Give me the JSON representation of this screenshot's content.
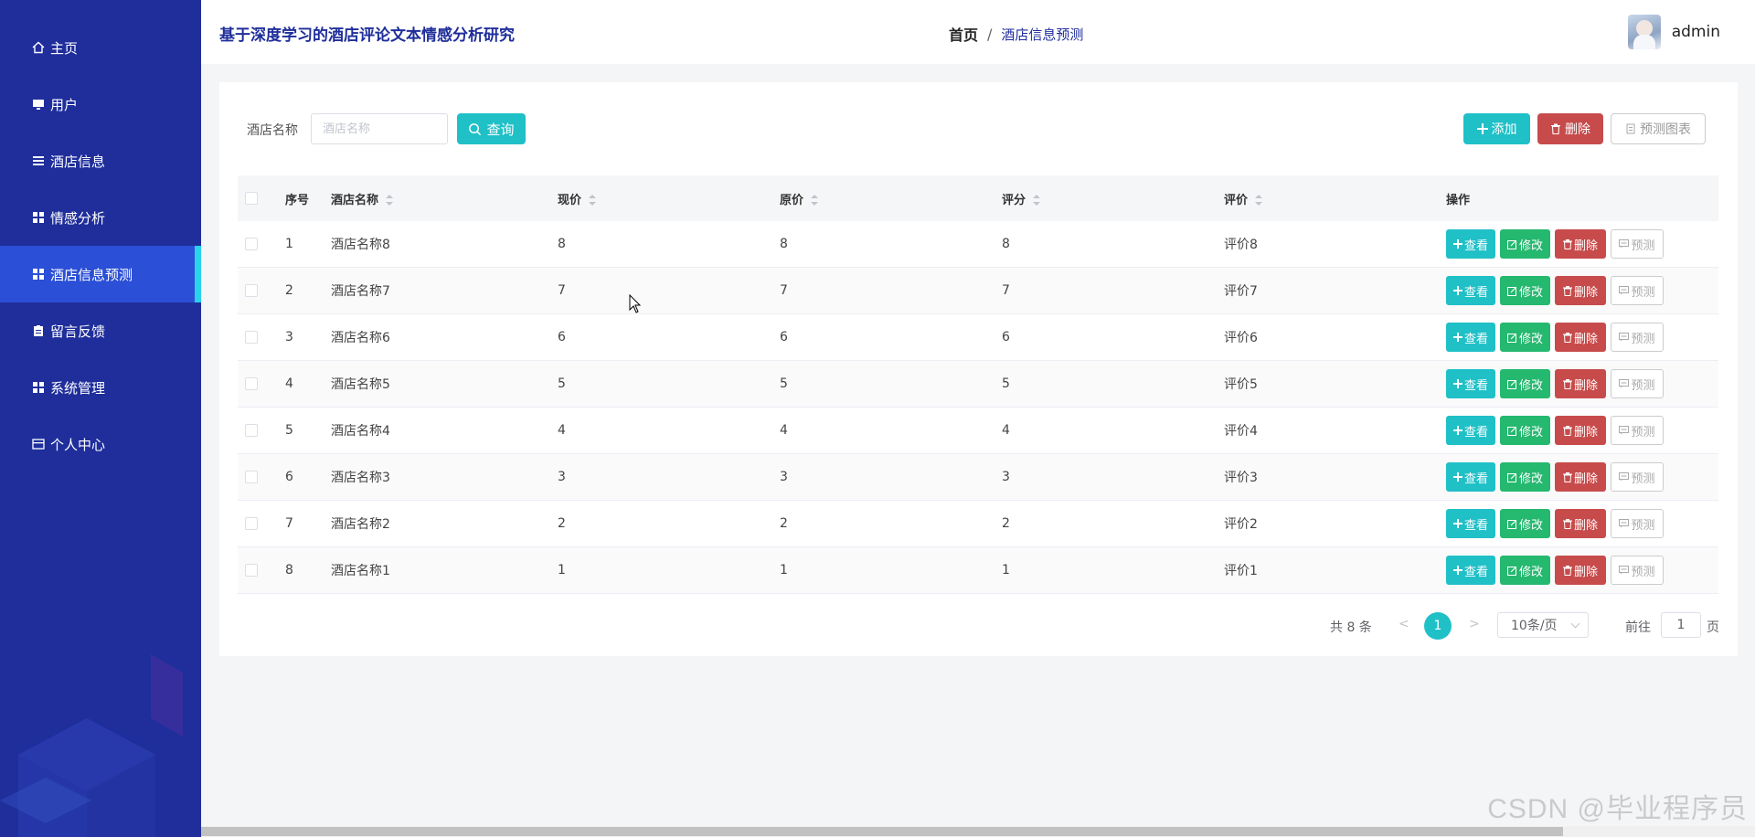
{
  "sidebar": {
    "items": [
      {
        "label": "主页",
        "icon": "home-icon",
        "active": false
      },
      {
        "label": "用户",
        "icon": "monitor-icon",
        "active": false
      },
      {
        "label": "酒店信息",
        "icon": "list-icon",
        "active": false
      },
      {
        "label": "情感分析",
        "icon": "grid-icon",
        "active": false
      },
      {
        "label": "酒店信息预测",
        "icon": "grid-icon",
        "active": true
      },
      {
        "label": "留言反馈",
        "icon": "clipboard-icon",
        "active": false
      },
      {
        "label": "系统管理",
        "icon": "grid-icon",
        "active": false
      },
      {
        "label": "个人中心",
        "icon": "card-icon",
        "active": false
      }
    ]
  },
  "header": {
    "site_title": "基于深度学习的酒店评论文本情感分析研究",
    "breadcrumb_home": "首页",
    "breadcrumb_sep": "/",
    "breadcrumb_current": "酒店信息预测",
    "username": "admin"
  },
  "search": {
    "label": "酒店名称",
    "placeholder": "酒店名称",
    "button_label": "查询"
  },
  "toolbar": {
    "add_label": "添加",
    "delete_label": "删除",
    "chart_label": "预测图表"
  },
  "table": {
    "headers": [
      "序号",
      "酒店名称",
      "现价",
      "原价",
      "评分",
      "评价",
      "操作"
    ],
    "ops": {
      "view": "查看",
      "edit": "修改",
      "delete": "删除",
      "predict": "预测"
    },
    "rows": [
      {
        "idx": "1",
        "name": "酒店名称8",
        "now": "8",
        "orig": "8",
        "score": "8",
        "eval": "评价8"
      },
      {
        "idx": "2",
        "name": "酒店名称7",
        "now": "7",
        "orig": "7",
        "score": "7",
        "eval": "评价7"
      },
      {
        "idx": "3",
        "name": "酒店名称6",
        "now": "6",
        "orig": "6",
        "score": "6",
        "eval": "评价6"
      },
      {
        "idx": "4",
        "name": "酒店名称5",
        "now": "5",
        "orig": "5",
        "score": "5",
        "eval": "评价5"
      },
      {
        "idx": "5",
        "name": "酒店名称4",
        "now": "4",
        "orig": "4",
        "score": "4",
        "eval": "评价4"
      },
      {
        "idx": "6",
        "name": "酒店名称3",
        "now": "3",
        "orig": "3",
        "score": "3",
        "eval": "评价3"
      },
      {
        "idx": "7",
        "name": "酒店名称2",
        "now": "2",
        "orig": "2",
        "score": "2",
        "eval": "评价2"
      },
      {
        "idx": "8",
        "name": "酒店名称1",
        "now": "1",
        "orig": "1",
        "score": "1",
        "eval": "评价1"
      }
    ]
  },
  "pagination": {
    "total": "共 8 条",
    "prev": "<",
    "current": "1",
    "next": ">",
    "page_size": "10条/页",
    "goto_label": "前往",
    "goto_value": "1",
    "page_suffix": "页"
  },
  "watermark": "CSDN @毕业程序员",
  "colors": {
    "sidebar_bg": "#1f2e9b",
    "sidebar_active": "#2b4fd6",
    "accent_cyan": "#20c0c7",
    "edit_green": "#25b86f",
    "delete_red": "#c74b4b"
  }
}
